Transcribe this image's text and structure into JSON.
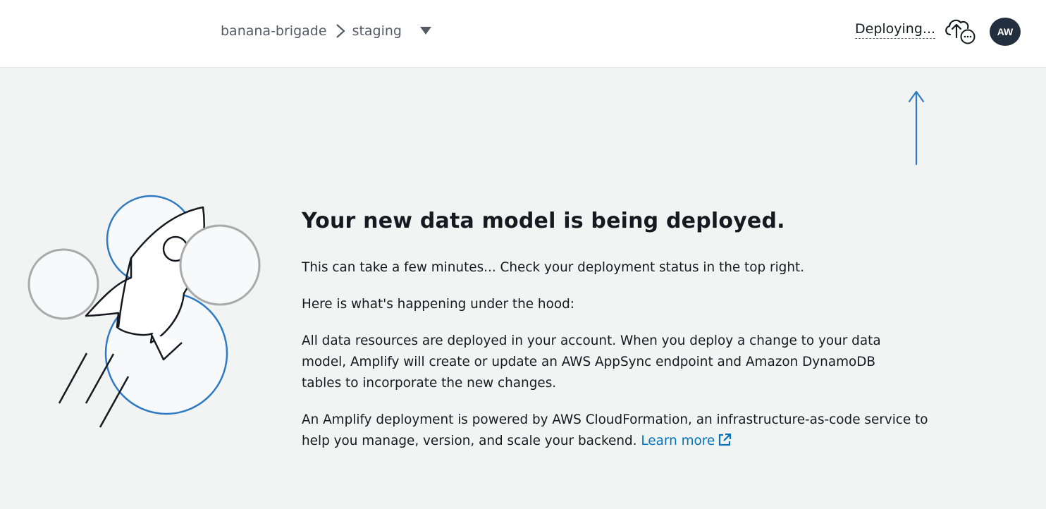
{
  "header": {
    "breadcrumb": {
      "app_name": "banana-brigade",
      "env_name": "staging"
    },
    "deploy_status": "Deploying...",
    "avatar_initials": "AW"
  },
  "main": {
    "headline": "Your new data model is being deployed.",
    "para_1": "This can take a few minutes... Check your deployment status in the top right.",
    "para_2": "Here is what's happening under the hood:",
    "para_3": "All data resources are deployed in your account. When you deploy a change to your data model, Amplify will create or update an AWS AppSync endpoint and Amazon DynamoDB tables to incorporate the new changes.",
    "para_4": "An Amplify deployment is powered by AWS CloudFormation, an infrastructure-as-code service to help you manage, version, and scale your backend.",
    "learn_more": "Learn more"
  },
  "icons": {
    "breadcrumb_separator": "chevron-right-icon",
    "env_dropdown": "caret-down-icon",
    "deploy_cloud": "cloud-upload-icon",
    "external_link": "external-link-icon",
    "illustration": "rocket-illustration",
    "pointer": "arrow-up-icon"
  },
  "colors": {
    "link": "#0073bb",
    "avatar_bg": "#232f3e",
    "page_bg": "#f2f3f3",
    "accent_blue": "#2e7bc4"
  }
}
